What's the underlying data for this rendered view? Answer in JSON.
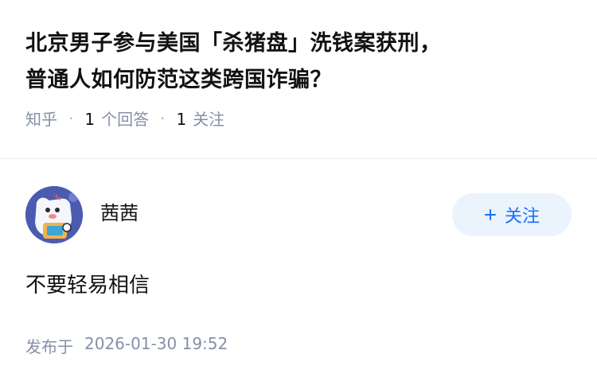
{
  "question": {
    "title_line1": "北京男子参与美国「杀猪盘」洗钱案获刑，",
    "title_line2": "普通人如何防范这类跨国诈骗？",
    "source": "知乎",
    "answer_count": "1",
    "answer_label": "个回答",
    "follower_count": "1",
    "follower_label": "关注"
  },
  "author": {
    "name": "茜茜",
    "follow_icon": "plus-icon",
    "follow_label": "关注"
  },
  "answer": {
    "content": "不要轻易相信",
    "published_prefix": "发布于",
    "published_time": "2026-01-30 19:52"
  },
  "colors": {
    "accent": "#1772f6",
    "follow_bg": "#ebf3fd",
    "muted_text": "#8590a6",
    "avatar_bg": "#4a5bb0"
  }
}
